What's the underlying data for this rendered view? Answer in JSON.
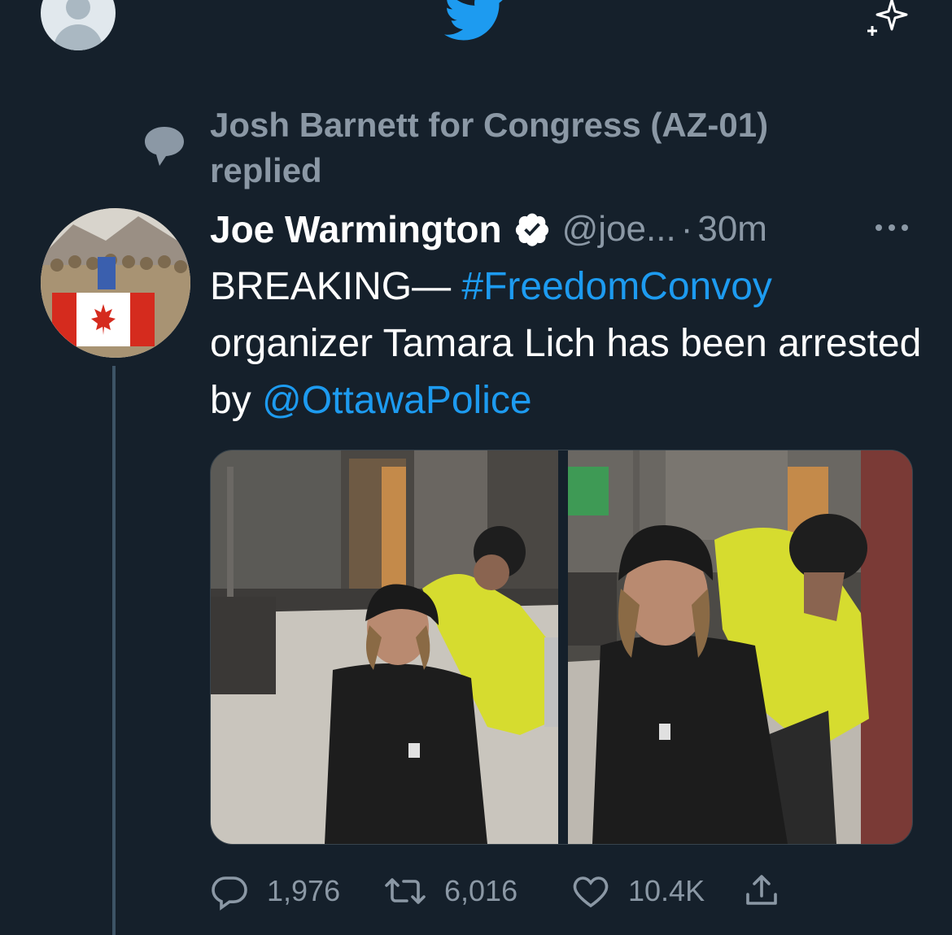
{
  "top_bar": {
    "profile_avatar_icon": "default-avatar-icon",
    "logo_icon": "twitter-bird-icon",
    "sparkle_icon": "sparkle-icon",
    "accent_color": "#1d9bf0"
  },
  "context": {
    "icon": "speech-bubble-icon",
    "text": "Josh Barnett for Congress (AZ-01) replied"
  },
  "tweet": {
    "display_name": "Joe Warmington",
    "verified_icon": "verified-badge-icon",
    "handle": "@joe...",
    "separator": "·",
    "time": "30m",
    "more_icon": "more-icon",
    "text_parts": [
      "BREAKING—",
      "#FreedomConvoy",
      "organizer Tamara Lich has been arrested by",
      "@OttawaPolice"
    ],
    "media_count": 2,
    "actions": {
      "reply_count": "1,976",
      "retweet_count": "6,016",
      "like_count": "10.4K"
    }
  },
  "colors": {
    "background": "#15202b",
    "secondary_text": "#8b98a5",
    "link": "#1d9bf0",
    "thread_line": "#3d5466"
  }
}
